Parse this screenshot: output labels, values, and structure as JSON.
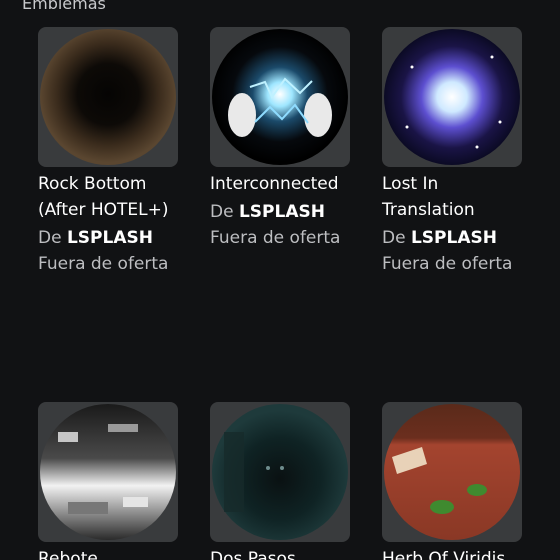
{
  "section": {
    "title": "Emblemas"
  },
  "creator_prefix": "De",
  "badges": [
    {
      "name": "Rock Bottom (After HOTEL+)",
      "creator": "LSPLASH",
      "price": "Fuera de oferta",
      "icon": "rock-bottom-badge-image"
    },
    {
      "name": "Interconnected",
      "creator": "LSPLASH",
      "price": "Fuera de oferta",
      "icon": "interconnected-badge-image"
    },
    {
      "name": "Lost In Translation",
      "creator": "LSPLASH",
      "price": "Fuera de oferta",
      "icon": "lost-in-translation-badge-image"
    },
    {
      "name": "Rebote",
      "icon": "rebote-badge-image"
    },
    {
      "name": "Dos Pasos",
      "icon": "dos-pasos-badge-image"
    },
    {
      "name": "Herb Of Viridis",
      "icon": "herb-of-viridis-badge-image"
    }
  ]
}
